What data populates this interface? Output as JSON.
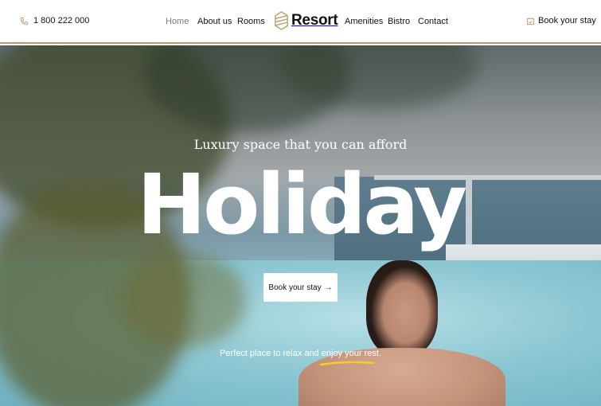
{
  "header": {
    "phone": "1 800 222 000",
    "nav_left": [
      "Home",
      "About us",
      "Rooms"
    ],
    "logo": "Resort",
    "nav_right": [
      "Amenities",
      "Bistro",
      "Contact"
    ],
    "book_label": "Book your stay"
  },
  "hero": {
    "tagline": "Luxury space that you can afford",
    "headline": "Holiday",
    "cta_label": "Book your stay",
    "cta_arrow": "→",
    "subline": "Perfect place to relax and enjoy your rest."
  },
  "colors": {
    "accent": "#b89a6a",
    "underline": "#f2cf2a",
    "text": "#111111"
  },
  "icons": {
    "phone": "phone-icon",
    "logo": "hexagon-logo-icon",
    "calendar": "calendar-check-icon"
  }
}
